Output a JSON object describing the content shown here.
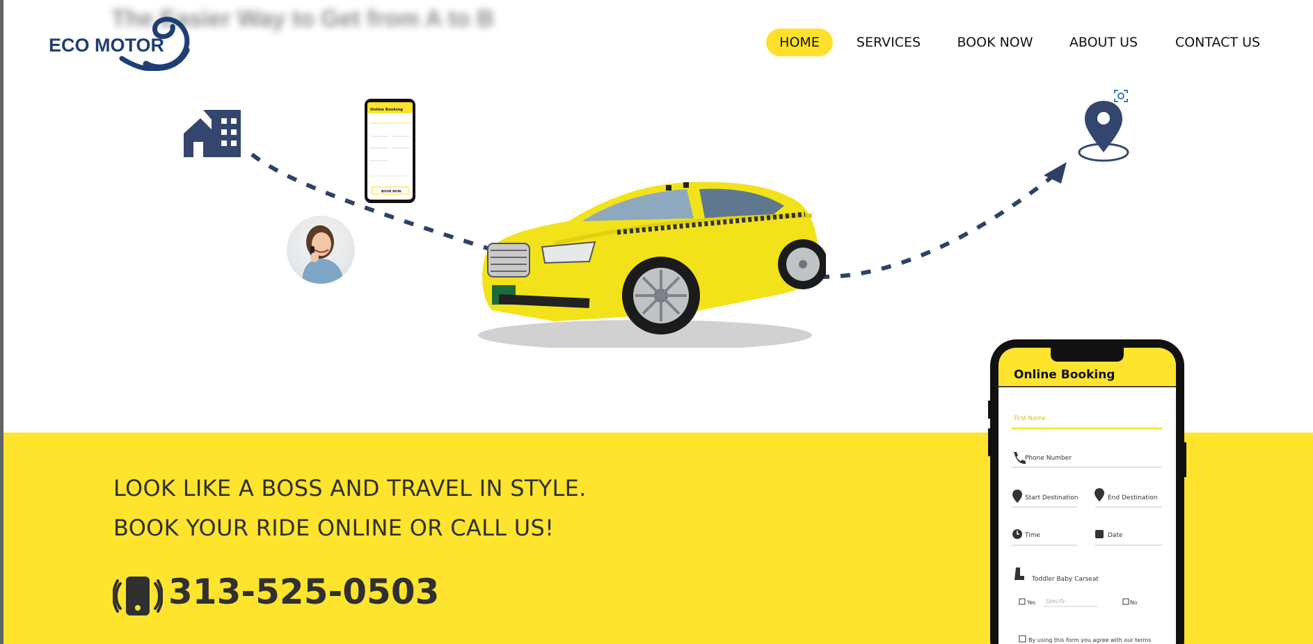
{
  "background_text": "The Easier Way to Get from A to B",
  "brand": {
    "name": "ECO MOTOR",
    "colors": {
      "primary": "#1e3f73",
      "accent": "#ffe42e",
      "text": "#303030"
    }
  },
  "nav": {
    "items": [
      {
        "label": "HOME",
        "active": true
      },
      {
        "label": "SERVICES",
        "active": false
      },
      {
        "label": "BOOK NOW",
        "active": false
      },
      {
        "label": "ABOUT US",
        "active": false
      },
      {
        "label": "CONTACT US",
        "active": false
      }
    ]
  },
  "hero": {
    "icons": [
      "house-icon",
      "phone-booking-icon",
      "customer-avatar",
      "taxi-car-image",
      "map-pin-icon",
      "scan-icon"
    ]
  },
  "small_phone": {
    "title": "Online Booking",
    "button": "BOOK NOW"
  },
  "banner": {
    "line1": "LOOK LIKE A BOSS AND TRAVEL IN STYLE.",
    "line2": "BOOK YOUR RIDE ONLINE OR CALL US!",
    "phone": "313-525-0503",
    "phone_icon": "phone-ringing-icon"
  },
  "booking_form": {
    "title": "Online Booking",
    "first_name_placeholder": "First Name",
    "phone_placeholder": "Phone Number",
    "start_placeholder": "Start Destination",
    "end_placeholder": "End Destination",
    "time_placeholder": "Time",
    "date_placeholder": "Date",
    "carseat_label": "Toddler Baby Carseat",
    "yes_label": "Yes",
    "specify_placeholder": "Specify",
    "no_label": "No",
    "terms_label": "By using this form you agree with our terms"
  }
}
